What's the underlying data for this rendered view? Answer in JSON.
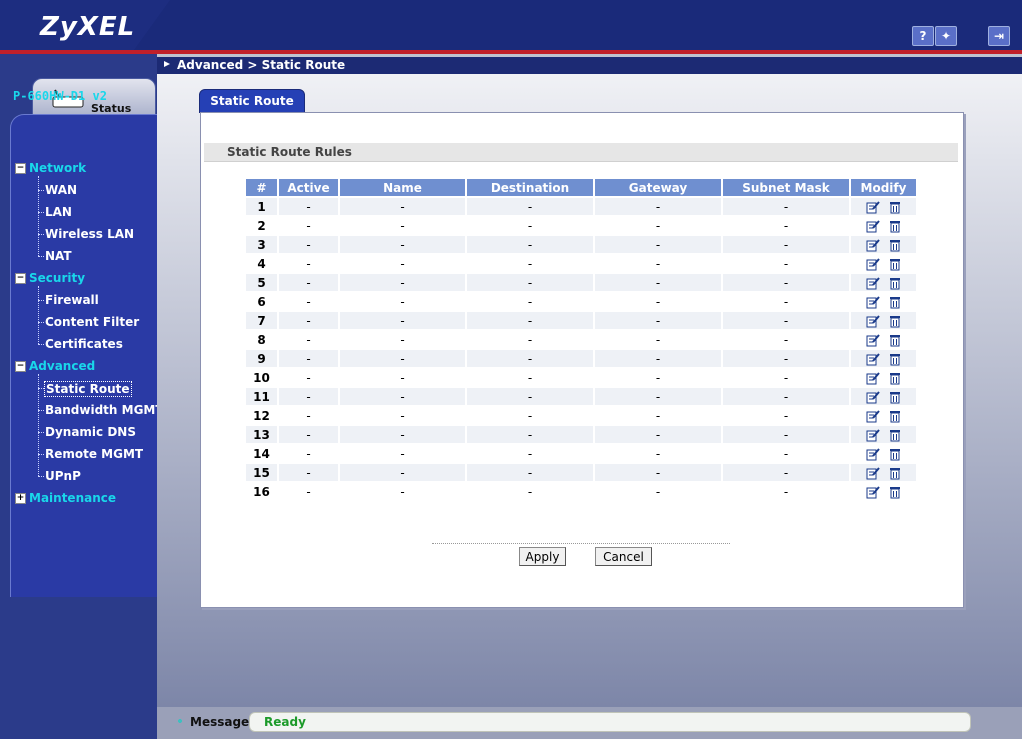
{
  "header": {
    "brand": "ZyXEL",
    "buttons": [
      {
        "name": "help-button",
        "glyph": "?"
      },
      {
        "name": "wizard-button",
        "glyph": "✦"
      },
      {
        "name": "logout-button",
        "glyph": "⇥"
      }
    ]
  },
  "sidebar": {
    "status_label": "Status",
    "model": "P-660HW-D1 v2",
    "groups": [
      {
        "label": "Network",
        "expanded": true,
        "items": [
          "WAN",
          "LAN",
          "Wireless LAN",
          "NAT"
        ]
      },
      {
        "label": "Security",
        "expanded": true,
        "items": [
          "Firewall",
          "Content Filter",
          "Certificates"
        ]
      },
      {
        "label": "Advanced",
        "expanded": true,
        "items": [
          "Static Route",
          "Bandwidth MGMT",
          "Dynamic DNS",
          "Remote MGMT",
          "UPnP"
        ]
      },
      {
        "label": "Maintenance",
        "expanded": false,
        "items": []
      }
    ],
    "selected": "Static Route"
  },
  "breadcrumb": "Advanced > Static Route",
  "tab": "Static Route",
  "section_title": "Static Route Rules",
  "table": {
    "columns": [
      "#",
      "Active",
      "Name",
      "Destination",
      "Gateway",
      "Subnet Mask",
      "Modify"
    ],
    "rows": [
      [
        "1",
        "-",
        "-",
        "-",
        "-",
        "-"
      ],
      [
        "2",
        "-",
        "-",
        "-",
        "-",
        "-"
      ],
      [
        "3",
        "-",
        "-",
        "-",
        "-",
        "-"
      ],
      [
        "4",
        "-",
        "-",
        "-",
        "-",
        "-"
      ],
      [
        "5",
        "-",
        "-",
        "-",
        "-",
        "-"
      ],
      [
        "6",
        "-",
        "-",
        "-",
        "-",
        "-"
      ],
      [
        "7",
        "-",
        "-",
        "-",
        "-",
        "-"
      ],
      [
        "8",
        "-",
        "-",
        "-",
        "-",
        "-"
      ],
      [
        "9",
        "-",
        "-",
        "-",
        "-",
        "-"
      ],
      [
        "10",
        "-",
        "-",
        "-",
        "-",
        "-"
      ],
      [
        "11",
        "-",
        "-",
        "-",
        "-",
        "-"
      ],
      [
        "12",
        "-",
        "-",
        "-",
        "-",
        "-"
      ],
      [
        "13",
        "-",
        "-",
        "-",
        "-",
        "-"
      ],
      [
        "14",
        "-",
        "-",
        "-",
        "-",
        "-"
      ],
      [
        "15",
        "-",
        "-",
        "-",
        "-",
        "-"
      ],
      [
        "16",
        "-",
        "-",
        "-",
        "-",
        "-"
      ]
    ]
  },
  "buttons": {
    "apply": "Apply",
    "cancel": "Cancel"
  },
  "footer": {
    "message_label": "Message",
    "message_value": "Ready"
  },
  "colors": {
    "accent": "#2540b5",
    "sidebar_heading": "#19d7ea",
    "status_ok": "#1c9a2a",
    "header_bg": "#1a2a7a"
  }
}
